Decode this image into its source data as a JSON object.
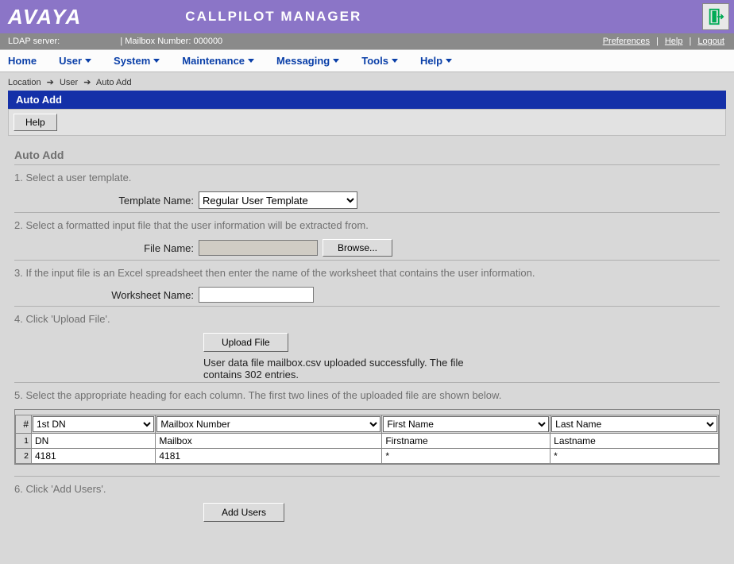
{
  "brand": "AVAYA",
  "appTitle": "CALLPILOT MANAGER",
  "status": {
    "ldapLabel": "LDAP server:",
    "ldapValue": "",
    "mailboxLabel": "| Mailbox Number:",
    "mailboxValue": "000000",
    "preferences": "Preferences",
    "help": "Help",
    "logout": "Logout"
  },
  "menu": {
    "home": "Home",
    "user": "User",
    "system": "System",
    "maintenance": "Maintenance",
    "messaging": "Messaging",
    "tools": "Tools",
    "help": "Help"
  },
  "breadcrumb": {
    "a": "Location",
    "b": "User",
    "c": "Auto Add"
  },
  "sectionTitle": "Auto Add",
  "helpBtn": "Help",
  "pageSubtitle": "Auto Add",
  "steps": {
    "s1": "1. Select a user template.",
    "s2": "2. Select a formatted input file that the user information will be extracted from.",
    "s3": "3. If the input file is an Excel spreadsheet then enter the name of the worksheet that contains the user information.",
    "s4": "4. Click 'Upload File'.",
    "s5": "5. Select the appropriate heading for each column. The first two lines of the uploaded file are shown below.",
    "s6": "6. Click 'Add Users'."
  },
  "labels": {
    "templateName": "Template Name:",
    "fileName": "File Name:",
    "worksheetName": "Worksheet Name:"
  },
  "templateSelected": "Regular User Template",
  "fileNameValue": "",
  "browseBtn": "Browse...",
  "worksheetValue": "",
  "uploadBtn": "Upload File",
  "uploadStatus": "User data file mailbox.csv uploaded successfully. The file contains 302 entries.",
  "columnHeaders": {
    "numSym": "#",
    "c1": "1st DN",
    "c2": "Mailbox Number",
    "c3": "First Name",
    "c4": "Last Name"
  },
  "previewRows": [
    {
      "n": "1",
      "c1": "DN",
      "c2": "Mailbox",
      "c3": "Firstname",
      "c4": "Lastname"
    },
    {
      "n": "2",
      "c1": "4181",
      "c2": "4181",
      "c3": "*",
      "c4": "*"
    }
  ],
  "addUsersBtn": "Add Users"
}
